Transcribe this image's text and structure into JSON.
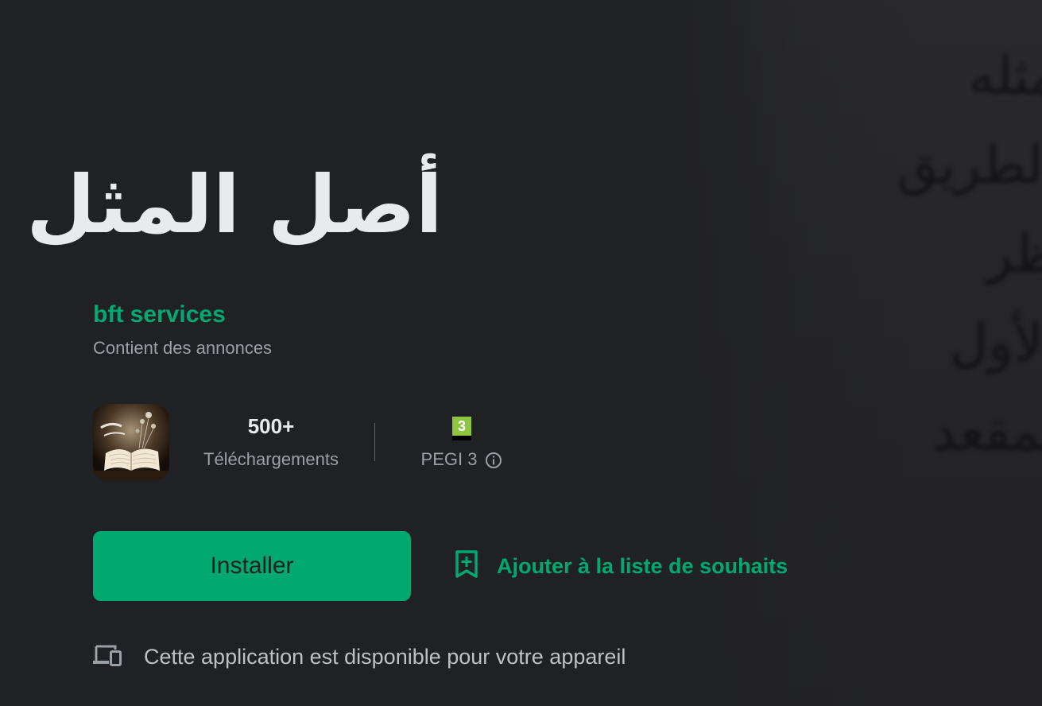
{
  "app": {
    "title": "أصل المثل",
    "developer": "bft services",
    "ads_notice": "Contient des annonces"
  },
  "stats": {
    "downloads_value": "500+",
    "downloads_label": "Téléchargements",
    "pegi_badge": "3",
    "pegi_label": "PEGI 3"
  },
  "actions": {
    "install_label": "Installer",
    "wishlist_label": "Ajouter à la liste de souhaits"
  },
  "availability": {
    "text": "Cette application est disponible pour votre appareil"
  },
  "icons": {
    "wishlist": "bookmark-add-icon",
    "info": "info-icon",
    "devices": "devices-icon"
  },
  "colors": {
    "background": "#202124",
    "accent": "#01a971",
    "text_primary": "#e8eaed",
    "text_secondary": "#9aa0a6",
    "pegi_green": "#8fc43f"
  }
}
